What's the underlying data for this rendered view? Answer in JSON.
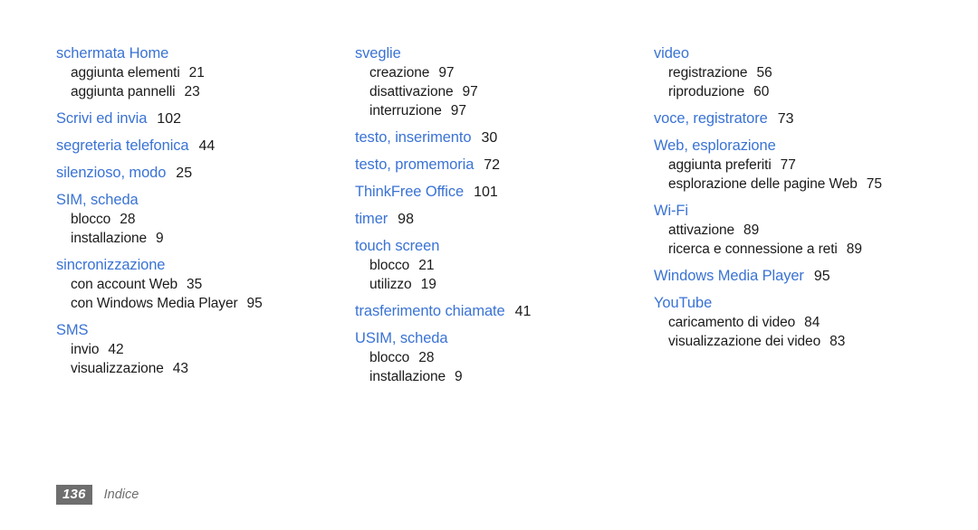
{
  "document": {
    "type": "index",
    "footer": {
      "page_number": "136",
      "section_label": "Indice"
    },
    "colors": {
      "heading": "#3a73d4",
      "body": "#1b1b1b",
      "footer_badge_bg": "#6e6e6e",
      "footer_badge_text": "#ffffff",
      "footer_label": "#6e6e6e",
      "background": "#ffffff"
    }
  },
  "columns": [
    {
      "groups": [
        {
          "heading": "schermata Home",
          "page": "",
          "entries": [
            {
              "label": "aggiunta elementi",
              "page": "21"
            },
            {
              "label": "aggiunta pannelli",
              "page": "23"
            }
          ]
        },
        {
          "heading": "Scrivi ed invia",
          "page": "102",
          "entries": []
        },
        {
          "heading": "segreteria telefonica",
          "page": "44",
          "entries": []
        },
        {
          "heading": "silenzioso, modo",
          "page": "25",
          "entries": []
        },
        {
          "heading": "SIM, scheda",
          "page": "",
          "entries": [
            {
              "label": "blocco",
              "page": "28"
            },
            {
              "label": "installazione",
              "page": "9"
            }
          ]
        },
        {
          "heading": "sincronizzazione",
          "page": "",
          "entries": [
            {
              "label": "con account Web",
              "page": "35"
            },
            {
              "label": "con Windows Media Player",
              "page": "95"
            }
          ]
        },
        {
          "heading": "SMS",
          "page": "",
          "entries": [
            {
              "label": "invio",
              "page": "42"
            },
            {
              "label": "visualizzazione",
              "page": "43"
            }
          ]
        }
      ]
    },
    {
      "groups": [
        {
          "heading": "sveglie",
          "page": "",
          "entries": [
            {
              "label": "creazione",
              "page": "97"
            },
            {
              "label": "disattivazione",
              "page": "97"
            },
            {
              "label": "interruzione",
              "page": "97"
            }
          ]
        },
        {
          "heading": "testo, inserimento",
          "page": "30",
          "entries": []
        },
        {
          "heading": "testo, promemoria",
          "page": "72",
          "entries": []
        },
        {
          "heading": "ThinkFree Office",
          "page": "101",
          "entries": []
        },
        {
          "heading": "timer",
          "page": "98",
          "entries": []
        },
        {
          "heading": "touch screen",
          "page": "",
          "entries": [
            {
              "label": "blocco",
              "page": "21"
            },
            {
              "label": "utilizzo",
              "page": "19"
            }
          ]
        },
        {
          "heading": "trasferimento chiamate",
          "page": "41",
          "entries": []
        },
        {
          "heading": "USIM, scheda",
          "page": "",
          "entries": [
            {
              "label": "blocco",
              "page": "28"
            },
            {
              "label": "installazione",
              "page": "9"
            }
          ]
        }
      ]
    },
    {
      "groups": [
        {
          "heading": "video",
          "page": "",
          "entries": [
            {
              "label": "registrazione",
              "page": "56"
            },
            {
              "label": "riproduzione",
              "page": "60"
            }
          ]
        },
        {
          "heading": "voce, registratore",
          "page": "73",
          "entries": []
        },
        {
          "heading": "Web, esplorazione",
          "page": "",
          "entries": [
            {
              "label": "aggiunta preferiti",
              "page": "77"
            },
            {
              "label": "esplorazione delle pagine Web",
              "page": "75"
            }
          ]
        },
        {
          "heading": "Wi-Fi",
          "page": "",
          "entries": [
            {
              "label": "attivazione",
              "page": "89"
            },
            {
              "label": "ricerca e connessione a reti",
              "page": "89"
            }
          ]
        },
        {
          "heading": "Windows Media Player",
          "page": "95",
          "entries": []
        },
        {
          "heading": "YouTube",
          "page": "",
          "entries": [
            {
              "label": "caricamento di video",
              "page": "84"
            },
            {
              "label": "visualizzazione dei video",
              "page": "83"
            }
          ]
        }
      ]
    }
  ]
}
